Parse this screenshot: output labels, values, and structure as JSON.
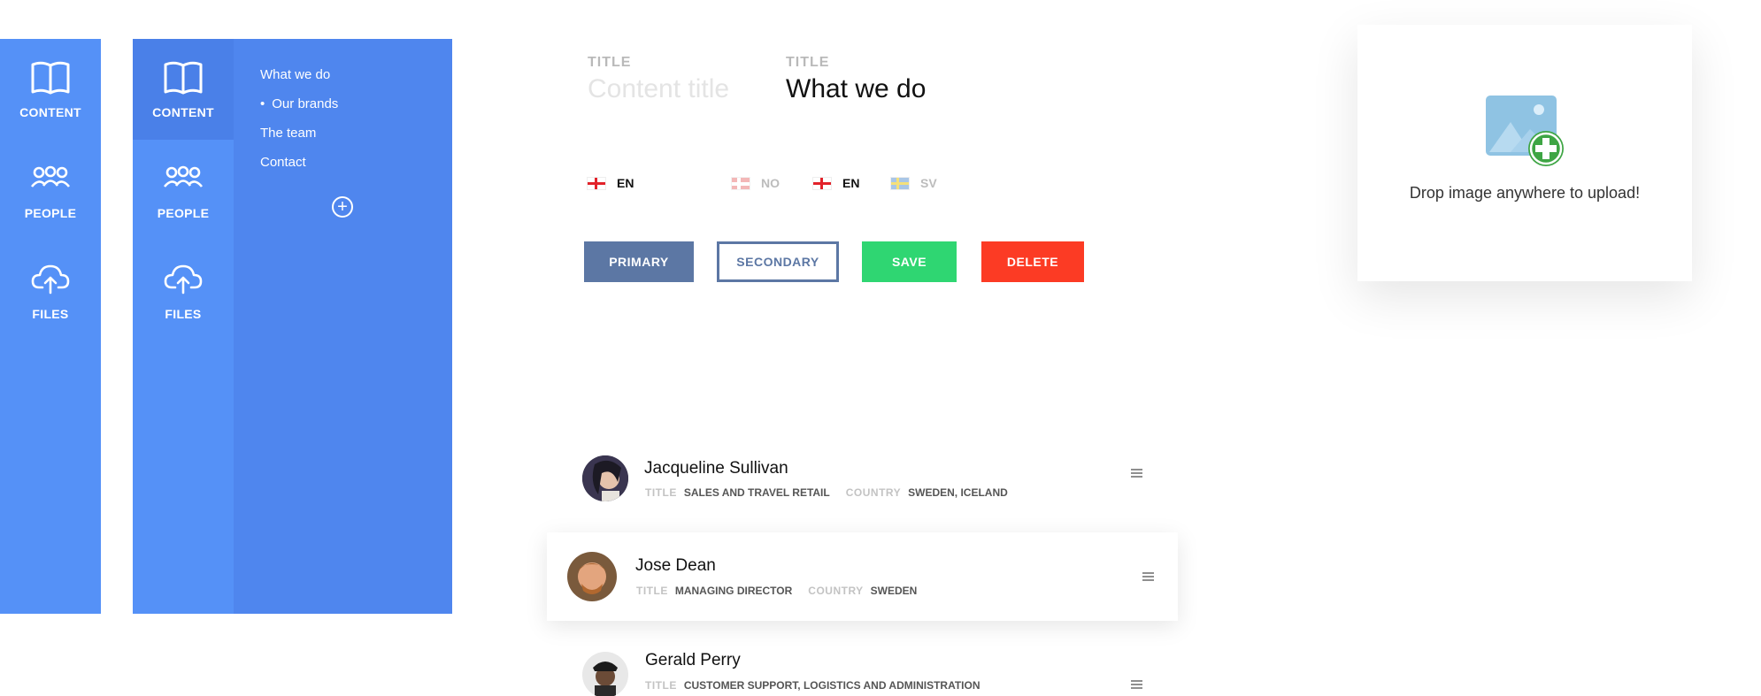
{
  "sidebar": {
    "items": [
      {
        "label": "CONTENT",
        "icon": "book-icon"
      },
      {
        "label": "PEOPLE",
        "icon": "people-icon"
      },
      {
        "label": "FILES",
        "icon": "cloud-upload-icon"
      }
    ]
  },
  "submenu": {
    "items": [
      "What we do",
      "Our brands",
      "The team",
      "Contact"
    ],
    "add_icon": "plus-circle-icon"
  },
  "fields": [
    {
      "label": "TITLE",
      "placeholder": "Content title",
      "value": ""
    },
    {
      "label": "TITLE",
      "value": "What we do"
    }
  ],
  "languages": [
    {
      "code": "EN",
      "flag": "flag-england-icon",
      "active": true
    },
    {
      "code": "NO",
      "flag": "flag-norway-icon",
      "active": false
    },
    {
      "code": "EN",
      "flag": "flag-england-icon",
      "active": true
    },
    {
      "code": "SV",
      "flag": "flag-sweden-icon",
      "active": false
    }
  ],
  "buttons": {
    "primary": "PRIMARY",
    "secondary": "SECONDARY",
    "save": "SAVE",
    "delete": "DELETE"
  },
  "upload": {
    "text": "Drop image anywhere to upload!",
    "icon": "image-add-icon"
  },
  "people": [
    {
      "name": "Jacqueline Sullivan",
      "title_label": "TITLE",
      "title": "SALES AND TRAVEL RETAIL",
      "country_label": "COUNTRY",
      "country": "SWEDEN, ICELAND"
    },
    {
      "name": "Jose Dean",
      "title_label": "TITLE",
      "title": "MANAGING DIRECTOR",
      "country_label": "COUNTRY",
      "country": "SWEDEN"
    },
    {
      "name": "Gerald Perry",
      "title_label": "TITLE",
      "title": "CUSTOMER SUPPORT, LOGISTICS AND ADMINISTRATION"
    }
  ],
  "colors": {
    "sidebar": "#5591f7",
    "submenu": "#4f86ee",
    "primary": "#5c77a4",
    "save": "#2fd672",
    "delete": "#fc3b24"
  }
}
